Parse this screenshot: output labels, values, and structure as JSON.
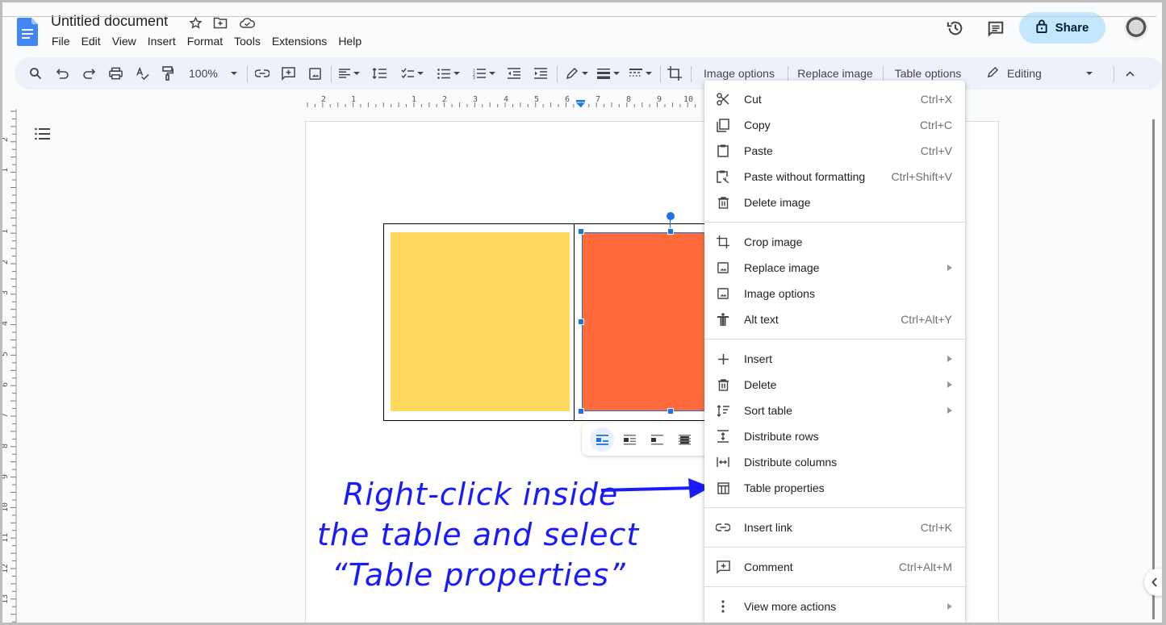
{
  "header": {
    "title": "Untitled document",
    "menus": [
      "File",
      "Edit",
      "View",
      "Insert",
      "Format",
      "Tools",
      "Extensions",
      "Help"
    ],
    "share_label": "Share",
    "icons": {
      "logo": "docs-logo-icon",
      "star": "star-icon",
      "move": "folder-move-icon",
      "cloud": "cloud-saved-icon",
      "history": "history-icon",
      "comments": "comments-icon",
      "lock": "lock-icon"
    }
  },
  "toolbar": {
    "zoom": "100%",
    "image_options": "Image options",
    "replace_image": "Replace image",
    "table_options": "Table options",
    "mode": "Editing"
  },
  "ruler": {
    "horizontal_ticks": [
      "2",
      "1",
      "1",
      "2",
      "3",
      "4",
      "5",
      "6",
      "7",
      "8",
      "9",
      "10"
    ],
    "vertical_ticks": [
      "2",
      "1",
      "1",
      "2",
      "3",
      "4",
      "5",
      "6",
      "7",
      "8",
      "9",
      "10",
      "11",
      "12",
      "13"
    ]
  },
  "document": {
    "table": {
      "rows": 1,
      "cols": 2
    },
    "images": [
      {
        "name": "yellow-square",
        "color": "#FFD95E"
      },
      {
        "name": "orange-rectangle",
        "color": "#FF6B3A",
        "selected": true
      }
    ],
    "wrap_options": [
      "inline",
      "wrap-text",
      "break-text",
      "behind-text"
    ]
  },
  "annotation": {
    "lines": [
      "Right-click inside",
      "the table and select",
      "“Table properties”"
    ],
    "color": "#1A1AFF"
  },
  "context_menu": {
    "groups": [
      [
        {
          "label": "Cut",
          "shortcut": "Ctrl+X",
          "icon": "cut-icon"
        },
        {
          "label": "Copy",
          "shortcut": "Ctrl+C",
          "icon": "copy-icon"
        },
        {
          "label": "Paste",
          "shortcut": "Ctrl+V",
          "icon": "paste-icon"
        },
        {
          "label": "Paste without formatting",
          "shortcut": "Ctrl+Shift+V",
          "icon": "paste-plain-icon"
        },
        {
          "label": "Delete image",
          "shortcut": "",
          "icon": "trash-icon"
        }
      ],
      [
        {
          "label": "Crop image",
          "shortcut": "",
          "icon": "crop-icon"
        },
        {
          "label": "Replace image",
          "shortcut": "",
          "icon": "image-icon",
          "submenu": true
        },
        {
          "label": "Image options",
          "shortcut": "",
          "icon": "image-icon"
        },
        {
          "label": "Alt text",
          "shortcut": "Ctrl+Alt+Y",
          "icon": "accessibility-icon"
        }
      ],
      [
        {
          "label": "Insert",
          "shortcut": "",
          "icon": "plus-icon",
          "submenu": true
        },
        {
          "label": "Delete",
          "shortcut": "",
          "icon": "trash-icon",
          "submenu": true
        },
        {
          "label": "Sort table",
          "shortcut": "",
          "icon": "sort-icon",
          "submenu": true
        },
        {
          "label": "Distribute rows",
          "shortcut": "",
          "icon": "distribute-rows-icon"
        },
        {
          "label": "Distribute columns",
          "shortcut": "",
          "icon": "distribute-columns-icon"
        },
        {
          "label": "Table properties",
          "shortcut": "",
          "icon": "table-icon"
        }
      ],
      [
        {
          "label": "Insert link",
          "shortcut": "Ctrl+K",
          "icon": "link-icon"
        }
      ],
      [
        {
          "label": "Comment",
          "shortcut": "Ctrl+Alt+M",
          "icon": "comment-icon"
        }
      ],
      [
        {
          "label": "View more actions",
          "shortcut": "",
          "icon": "more-vert-icon",
          "submenu": true
        }
      ]
    ]
  }
}
